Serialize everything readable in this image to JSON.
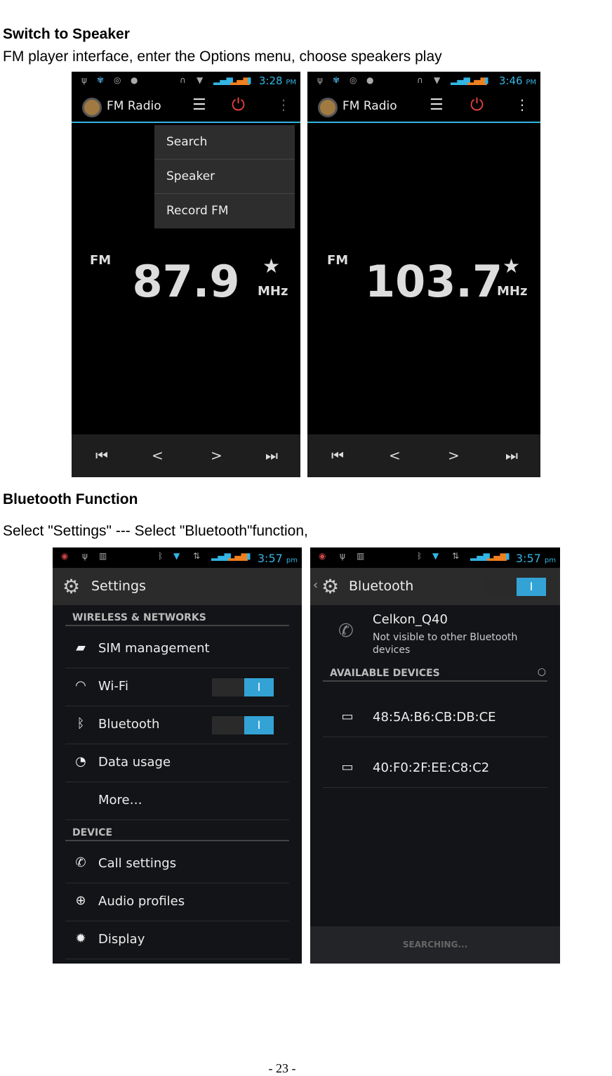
{
  "section1": {
    "heading": "Switch to Speaker",
    "text": "FM player interface, enter the Options menu, choose speakers play"
  },
  "fm_screens": [
    {
      "time": "3:28",
      "ampm": "PM",
      "app_title": "FM Radio",
      "menu": [
        "Search",
        "Speaker",
        "Record FM"
      ],
      "band": "FM",
      "frequency": "87.9",
      "unit": "MHz"
    },
    {
      "time": "3:46",
      "ampm": "PM",
      "app_title": "FM Radio",
      "band": "FM",
      "frequency": "103.7",
      "unit": "MHz"
    }
  ],
  "section2": {
    "heading": "Bluetooth Function",
    "text": "Select \"Settings\" --- Select \"Bluetooth\"function,"
  },
  "settings_screen": {
    "time": "3:57",
    "ampm": "pm",
    "title": "Settings",
    "sections": [
      {
        "header": "WIRELESS & NETWORKS"
      },
      {
        "header": "DEVICE"
      }
    ],
    "items": [
      {
        "label": "SIM management",
        "icon": "sim-icon"
      },
      {
        "label": "Wi-Fi",
        "icon": "wifi-icon",
        "toggle": "I"
      },
      {
        "label": "Bluetooth",
        "icon": "bluetooth-icon",
        "toggle": "I"
      },
      {
        "label": "Data usage",
        "icon": "data-usage-icon"
      },
      {
        "label": "More…"
      },
      {
        "label": "Call settings",
        "icon": "phone-icon"
      },
      {
        "label": "Audio profiles",
        "icon": "audio-icon"
      },
      {
        "label": "Display",
        "icon": "display-icon"
      }
    ]
  },
  "bluetooth_screen": {
    "time": "3:57",
    "ampm": "pm",
    "title": "Bluetooth",
    "toggle": "I",
    "device_name": "Celkon_Q40",
    "device_status": "Not visible to other Bluetooth devices",
    "available_header": "AVAILABLE DEVICES",
    "devices": [
      "48:5A:B6:CB:DB:CE",
      "40:F0:2F:EE:C8:C2"
    ],
    "footer": "SEARCHING..."
  },
  "page_number": "- 23 -",
  "colors": {
    "accent": "#33b5e5",
    "power": "#e84040",
    "toggle_on": "#33a3d6"
  }
}
